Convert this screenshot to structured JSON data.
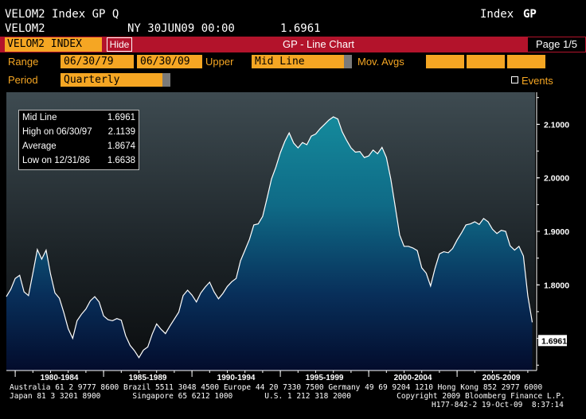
{
  "header": {
    "line1_left": "VELOM2 Index GP Q",
    "line1_right_a": "Index",
    "line1_right_b": "GP",
    "line2_ticker": "VELOM2",
    "line2_date": "NY 30JUN09 00:00",
    "line2_value": "1.6961"
  },
  "bar": {
    "security": "VELOM2 INDEX",
    "hide_label": "Hide",
    "title": "GP - Line Chart",
    "page": "Page 1/5"
  },
  "controls": {
    "range_label": "Range",
    "start_date": "06/30/79",
    "end_date": "06/30/09",
    "upper_label": "Upper",
    "upper_value": "Mid Line",
    "mov_avgs_label": "Mov. Avgs",
    "period_label": "Period",
    "period_value": "Quarterly",
    "events_label": "Events"
  },
  "tooltip": {
    "rows": [
      {
        "label": "Mid Line",
        "value": "1.6961"
      },
      {
        "label": "High on  06/30/97",
        "value": "2.1139"
      },
      {
        "label": "Average",
        "value": "1.8674"
      },
      {
        "label": "Low on  12/31/86",
        "value": "1.6638"
      }
    ]
  },
  "chart_data": {
    "type": "area",
    "y_tick_labels": [
      "2.1000",
      "2.0000",
      "1.9000",
      "1.8000"
    ],
    "y_ticks": [
      2.1,
      2.0,
      1.9,
      1.8
    ],
    "last_value_label": "1.6961",
    "x_tick_labels": [
      "1980-1984",
      "1985-1989",
      "1990-1994",
      "1995-1999",
      "2000-2004",
      "2005-2009"
    ],
    "ylim": [
      1.64,
      2.16
    ],
    "xlim": [
      1979.5,
      2009.5
    ],
    "grid": false,
    "x": [
      1979.5,
      1979.75,
      1980.0,
      1980.25,
      1980.5,
      1980.75,
      1981.0,
      1981.25,
      1981.5,
      1981.75,
      1982.0,
      1982.25,
      1982.5,
      1982.75,
      1983.0,
      1983.25,
      1983.5,
      1983.75,
      1984.0,
      1984.25,
      1984.5,
      1984.75,
      1985.0,
      1985.25,
      1985.5,
      1985.75,
      1986.0,
      1986.25,
      1986.5,
      1986.75,
      1987.0,
      1987.25,
      1987.5,
      1987.75,
      1988.0,
      1988.25,
      1988.5,
      1988.75,
      1989.0,
      1989.25,
      1989.5,
      1989.75,
      1990.0,
      1990.25,
      1990.5,
      1990.75,
      1991.0,
      1991.25,
      1991.5,
      1991.75,
      1992.0,
      1992.25,
      1992.5,
      1992.75,
      1993.0,
      1993.25,
      1993.5,
      1993.75,
      1994.0,
      1994.25,
      1994.5,
      1994.75,
      1995.0,
      1995.25,
      1995.5,
      1995.75,
      1996.0,
      1996.25,
      1996.5,
      1996.75,
      1997.0,
      1997.25,
      1997.5,
      1997.75,
      1998.0,
      1998.25,
      1998.5,
      1998.75,
      1999.0,
      1999.25,
      1999.5,
      1999.75,
      2000.0,
      2000.25,
      2000.5,
      2000.75,
      2001.0,
      2001.25,
      2001.5,
      2001.75,
      2002.0,
      2002.25,
      2002.5,
      2002.75,
      2003.0,
      2003.25,
      2003.5,
      2003.75,
      2004.0,
      2004.25,
      2004.5,
      2004.75,
      2005.0,
      2005.25,
      2005.5,
      2005.75,
      2006.0,
      2006.25,
      2006.5,
      2006.75,
      2007.0,
      2007.25,
      2007.5,
      2007.75,
      2008.0,
      2008.25,
      2008.5,
      2008.75,
      2009.0,
      2009.25
    ],
    "series": [
      {
        "values": [
          1.778,
          1.792,
          1.812,
          1.818,
          1.787,
          1.78,
          1.822,
          1.866,
          1.848,
          1.865,
          1.82,
          1.785,
          1.775,
          1.748,
          1.718,
          1.7,
          1.733,
          1.745,
          1.755,
          1.77,
          1.778,
          1.768,
          1.742,
          1.735,
          1.733,
          1.737,
          1.734,
          1.705,
          1.687,
          1.677,
          1.664,
          1.678,
          1.684,
          1.708,
          1.727,
          1.717,
          1.709,
          1.723,
          1.736,
          1.749,
          1.78,
          1.79,
          1.781,
          1.768,
          1.785,
          1.796,
          1.805,
          1.787,
          1.774,
          1.784,
          1.797,
          1.806,
          1.812,
          1.845,
          1.865,
          1.885,
          1.912,
          1.914,
          1.928,
          1.962,
          1.998,
          2.02,
          2.047,
          2.068,
          2.084,
          2.065,
          2.056,
          2.066,
          2.062,
          2.078,
          2.082,
          2.092,
          2.1,
          2.108,
          2.114,
          2.11,
          2.086,
          2.07,
          2.056,
          2.048,
          2.049,
          2.038,
          2.041,
          2.052,
          2.045,
          2.057,
          2.038,
          1.998,
          1.946,
          1.893,
          1.872,
          1.872,
          1.869,
          1.864,
          1.832,
          1.822,
          1.798,
          1.831,
          1.858,
          1.862,
          1.86,
          1.868,
          1.884,
          1.897,
          1.912,
          1.914,
          1.918,
          1.913,
          1.924,
          1.918,
          1.904,
          1.896,
          1.902,
          1.9,
          1.873,
          1.865,
          1.872,
          1.854,
          1.78,
          1.73,
          1.692,
          1.696
        ]
      }
    ]
  },
  "footer": {
    "line1": "Australia 61 2 9777 8600 Brazil 5511 3048 4500 Europe 44 20 7330 7500 Germany 49 69 9204 1210 Hong Kong 852 2977 6000",
    "line2": "Japan 81 3 3201 8900       Singapore 65 6212 1000       U.S. 1 212 318 2000          Copyright 2009 Bloomberg Finance L.P.",
    "line3": "H177-842-2 19-Oct-09  8:37:14"
  }
}
